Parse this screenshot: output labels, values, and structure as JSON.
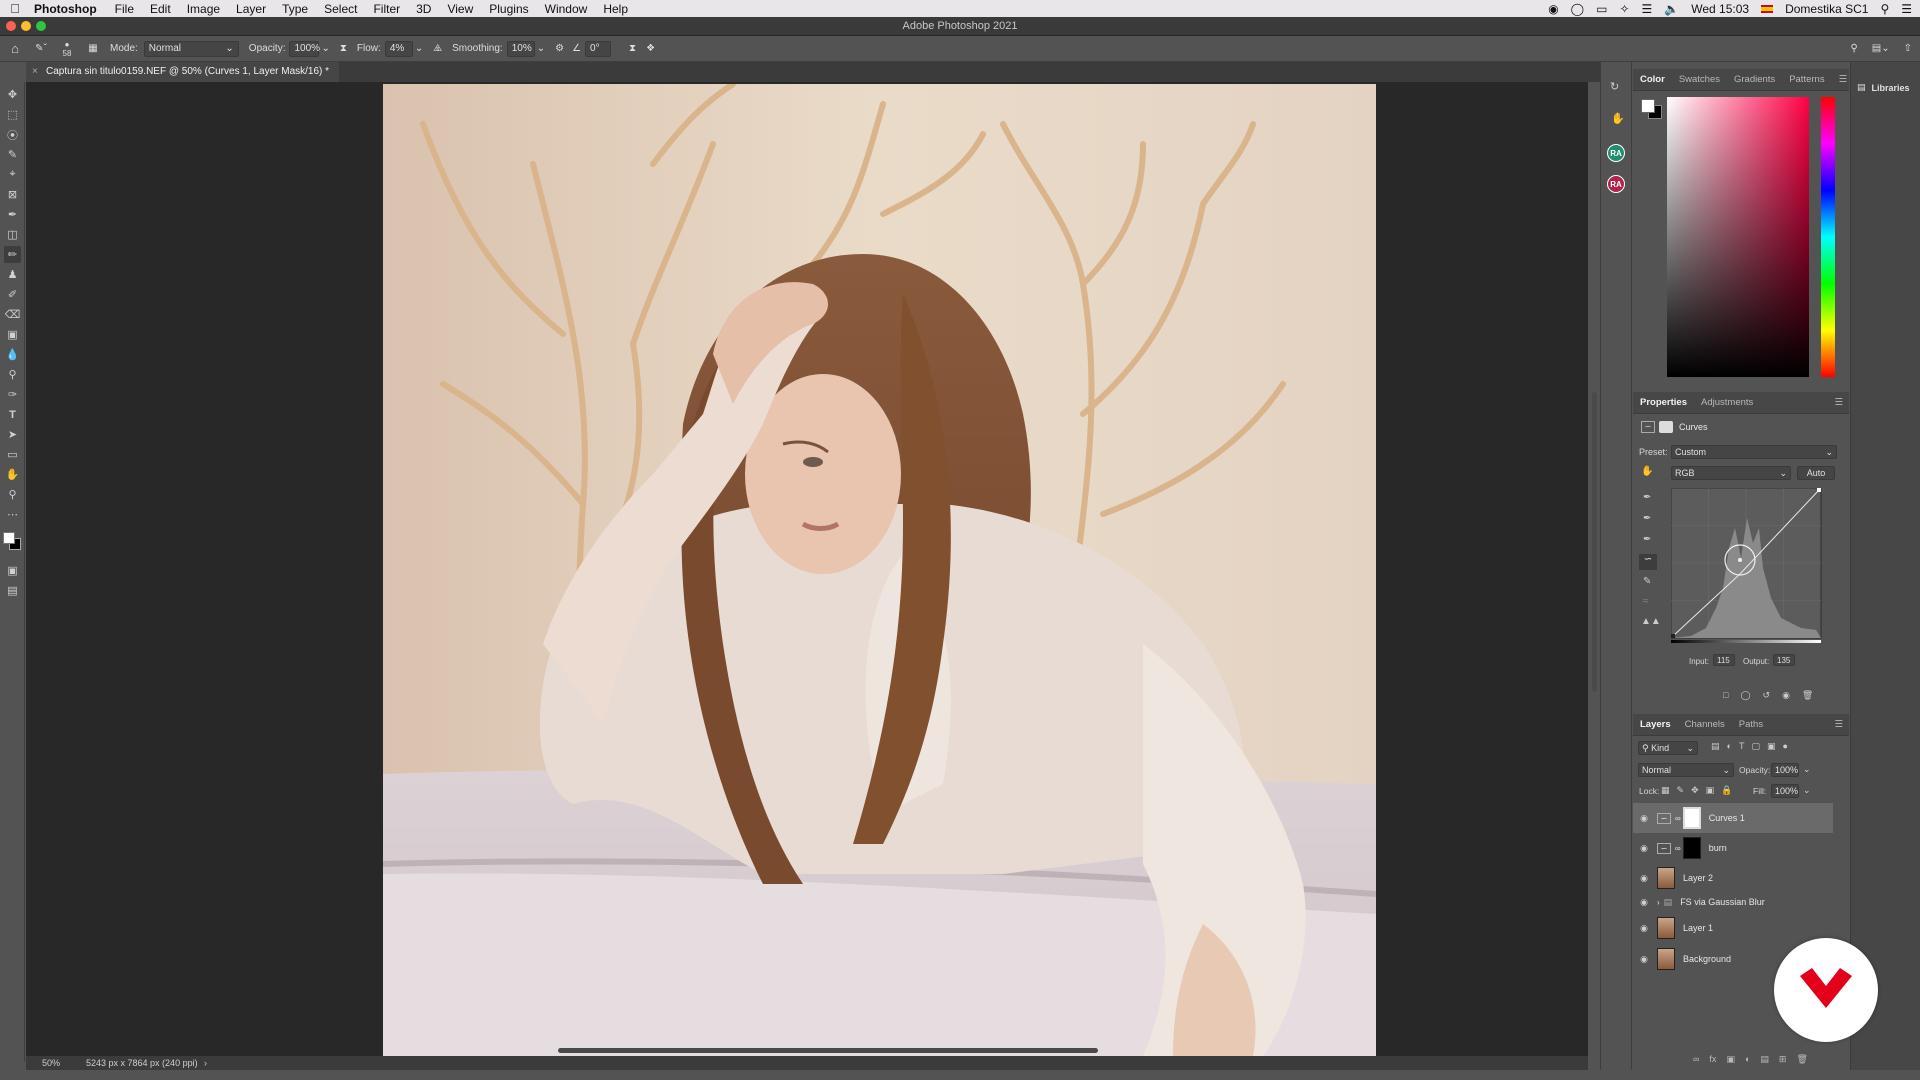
{
  "menubar": {
    "app": "Photoshop",
    "items": [
      "File",
      "Edit",
      "Image",
      "Layer",
      "Type",
      "Select",
      "Filter",
      "3D",
      "View",
      "Plugins",
      "Window",
      "Help"
    ],
    "clock": "Wed 15:03",
    "user": "Domestika SC1"
  },
  "window": {
    "title": "Adobe Photoshop 2021"
  },
  "options": {
    "brush_size": "58",
    "mode_label": "Mode:",
    "mode_value": "Normal",
    "opacity_label": "Opacity:",
    "opacity_value": "100%",
    "flow_label": "Flow:",
    "flow_value": "4%",
    "smoothing_label": "Smoothing:",
    "smoothing_value": "10%",
    "angle_value": "0°"
  },
  "document": {
    "tab_title": "Captura sin titulo0159.NEF @ 50% (Curves 1, Layer Mask/16) *",
    "zoom": "50%",
    "dimensions": "5243 px x 7864 px (240 ppi)"
  },
  "color_panel": {
    "tabs": [
      "Color",
      "Swatches",
      "Gradients",
      "Patterns"
    ],
    "active_tab": "Color",
    "hue_color": "#ff0044"
  },
  "properties_panel": {
    "tabs": [
      "Properties",
      "Adjustments"
    ],
    "type_label": "Curves",
    "preset_label": "Preset:",
    "preset_value": "Custom",
    "channel_value": "RGB",
    "auto_label": "Auto",
    "input_label": "Input:",
    "input_value": "115",
    "output_label": "Output:",
    "output_value": "135"
  },
  "layers_panel": {
    "tabs": [
      "Layers",
      "Channels",
      "Paths"
    ],
    "filter_value": "Kind",
    "blend_value": "Normal",
    "opacity_label": "Opacity:",
    "opacity_value": "100%",
    "lock_label": "Lock:",
    "fill_label": "Fill:",
    "fill_value": "100%",
    "layers": [
      {
        "name": "Curves 1",
        "kind": "adjustment",
        "selected": true
      },
      {
        "name": "burn",
        "kind": "adjustment-black-mask",
        "selected": false
      },
      {
        "name": "Layer 2",
        "kind": "pixel",
        "selected": false
      },
      {
        "name": "FS via Gaussian Blur",
        "kind": "group",
        "selected": false
      },
      {
        "name": "Layer 1",
        "kind": "pixel",
        "selected": false
      },
      {
        "name": "Background",
        "kind": "pixel",
        "selected": false
      }
    ]
  },
  "libraries": {
    "label": "Libraries"
  },
  "avatars": [
    "RA",
    "RA"
  ],
  "colors": {
    "accent_logo": "#e3001b",
    "background_swatch": "#ffffff",
    "foreground_swatch": "#000000"
  }
}
